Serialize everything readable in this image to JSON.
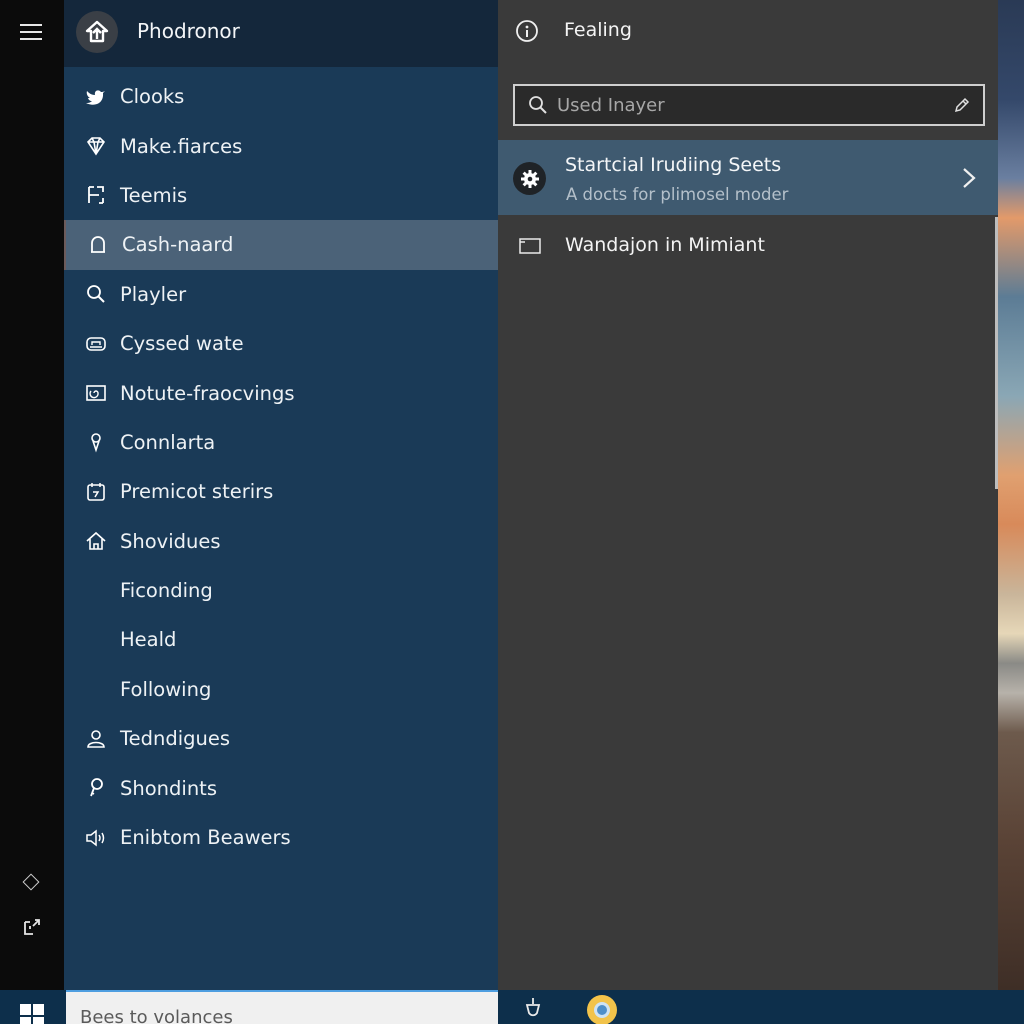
{
  "nav": {
    "header_title": "Phodronor",
    "items": [
      {
        "label": "Clooks",
        "icon": "bird-icon"
      },
      {
        "label": "Make.fiarces",
        "icon": "gem-icon"
      },
      {
        "label": "Teemis",
        "icon": "layout-icon"
      },
      {
        "label": "Cash-naard",
        "icon": "lock-icon",
        "selected": true
      },
      {
        "label": "Playler",
        "icon": "search-icon"
      },
      {
        "label": "Cyssed wate",
        "icon": "drive-icon"
      },
      {
        "label": "Notute-fraocvings",
        "icon": "swirl-icon"
      },
      {
        "label": "Connlarta",
        "icon": "location-pin-icon"
      },
      {
        "label": "Premicot sterirs",
        "icon": "calendar-icon"
      },
      {
        "label": "Shovidues",
        "icon": "home-icon"
      },
      {
        "label": "Ficonding",
        "icon": ""
      },
      {
        "label": "Heald",
        "icon": ""
      },
      {
        "label": "Following",
        "icon": ""
      },
      {
        "label": "Tedndigues",
        "icon": "person-icon"
      },
      {
        "label": "Shondints",
        "icon": "key-icon"
      },
      {
        "label": "Enibtom Beawers",
        "icon": "speaker-icon"
      }
    ]
  },
  "panel": {
    "title": "Fealing",
    "search_placeholder": "Used Inayer",
    "results": [
      {
        "title": "Startcial Irudiing Seets",
        "subtitle": "A docts for plimosel moder"
      },
      {
        "title": "Wandajon in Mimiant"
      }
    ]
  },
  "taskbar": {
    "search_placeholder": "Bees to volances"
  }
}
